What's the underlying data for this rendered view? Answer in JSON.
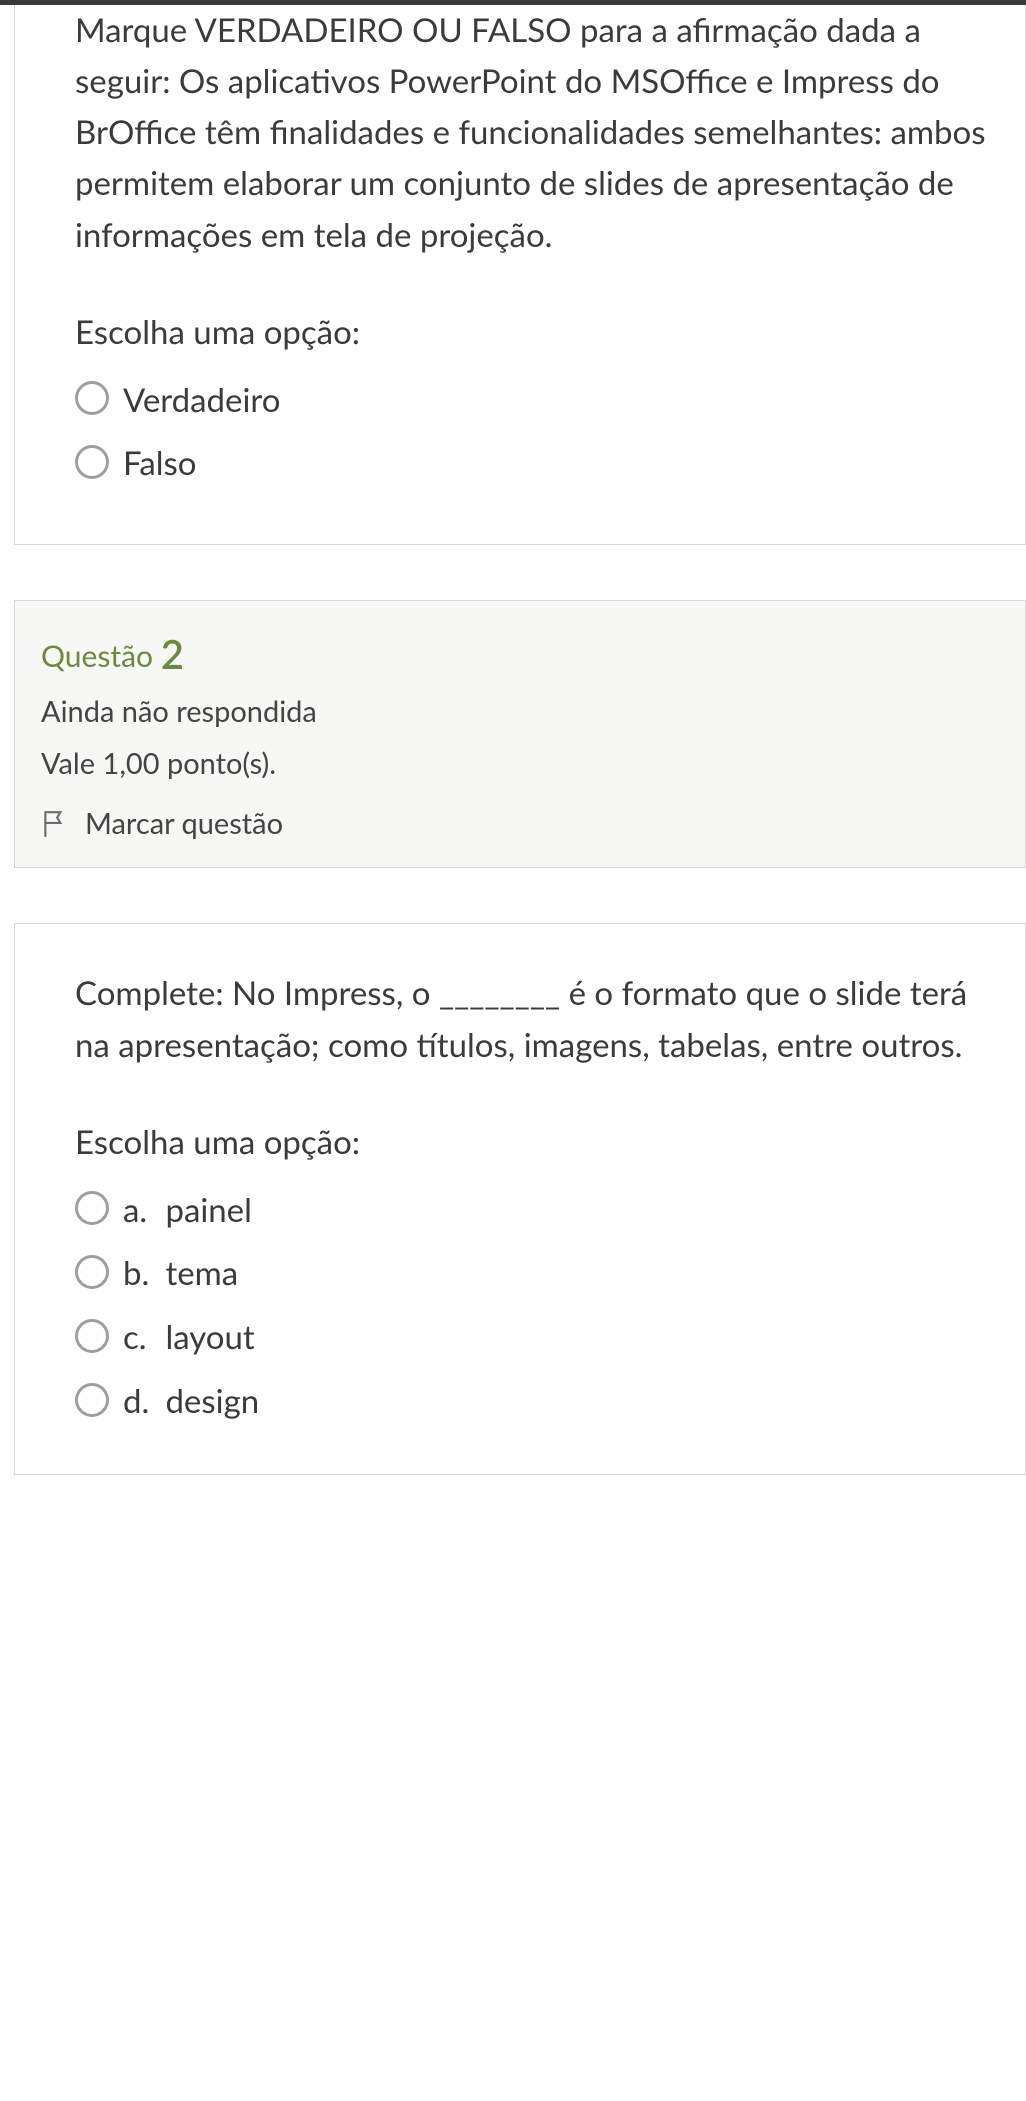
{
  "q1": {
    "text": "Marque VERDADEIRO OU FALSO para a afirmação dada a seguir: Os aplicativos PowerPoint do MSOffice e Impress do BrOffice têm finalidades e funcionalidades semelhantes: ambos permitem elaborar um conjunto de slides de apresentação de informações em tela de projeção.",
    "prompt": "Escolha uma opção:",
    "options": {
      "true": "Verdadeiro",
      "false": "Falso"
    }
  },
  "q2_info": {
    "heading_prefix": "Questão ",
    "number": "2",
    "status": "Ainda não respondida",
    "grade": "Vale 1,00 ponto(s).",
    "flag_label": "Marcar questão"
  },
  "q2": {
    "text": "Complete: No Impress, o ________ é o formato que o slide terá na apresentação; como títulos, imagens, tabelas, entre outros.",
    "prompt": "Escolha uma opção:",
    "options": {
      "a": {
        "letter": "a.",
        "label": "painel"
      },
      "b": {
        "letter": "b.",
        "label": "tema"
      },
      "c": {
        "letter": "c.",
        "label": "layout"
      },
      "d": {
        "letter": "d.",
        "label": "design"
      }
    }
  }
}
